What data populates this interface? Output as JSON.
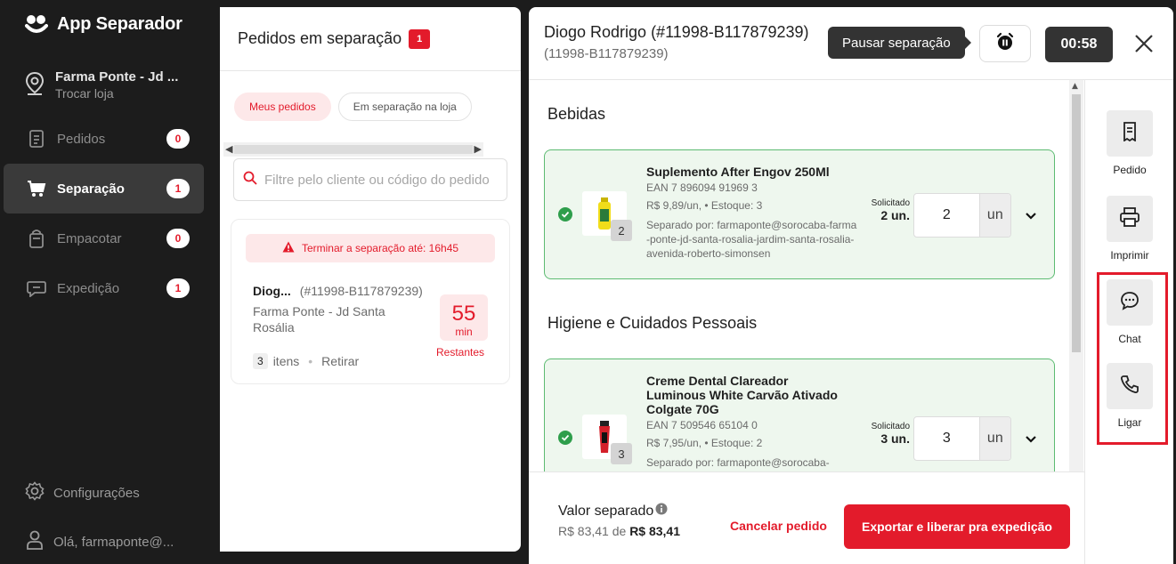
{
  "app": {
    "name": "App Separador"
  },
  "store": {
    "name": "Farma Ponte - Jd ...",
    "action": "Trocar loja"
  },
  "nav": [
    {
      "label": "Pedidos",
      "count": "0",
      "icon": "receipt-icon"
    },
    {
      "label": "Separação",
      "count": "1",
      "icon": "cart-icon"
    },
    {
      "label": "Empacotar",
      "count": "0",
      "icon": "bag-icon"
    },
    {
      "label": "Expedição",
      "count": "1",
      "icon": "chat-bubble-icon"
    }
  ],
  "bottom_nav": {
    "settings": "Configurações",
    "user": "Olá, farmaponte@..."
  },
  "orders_panel": {
    "title": "Pedidos em separação",
    "count": "1",
    "tabs": [
      "Meus pedidos",
      "Em separação na loja"
    ],
    "search_placeholder": "Filtre pelo cliente ou código do pedido",
    "order": {
      "deadline": "Terminar a separação até: 16h45",
      "customer": "Diog...",
      "code": "(#11998-B117879239)",
      "store": "Farma Ponte - Jd Santa Rosália",
      "minutes": "55",
      "minutes_unit": "min",
      "remaining_label": "Restantes",
      "items_count": "3",
      "items_label": "itens",
      "delivery": "Retirar"
    }
  },
  "detail": {
    "customer": "Diogo Rodrigo  (#11998-B117879239)",
    "code": "(11998-B117879239)",
    "tooltip": "Pausar separação",
    "timer": "00:58",
    "sections": [
      {
        "title": "Bebidas",
        "items": [
          {
            "name": "Suplemento After Engov 250Ml",
            "ean": "EAN 7 896094 91969 3",
            "price": "R$ 9,89/un, • Estoque: 3",
            "separated_by": "Separado por: farmaponte@sorocaba-farma-ponte-jd-santa-rosalia-jardim-santa-rosalia-avenida-roberto-simonsen",
            "badge": "2",
            "requested_label": "Solicitado",
            "requested": "2 un.",
            "qty": "2",
            "unit": "un"
          }
        ]
      },
      {
        "title": "Higiene e Cuidados Pessoais",
        "items": [
          {
            "name": "Creme Dental Clareador Luminous White Carvão Ativado Colgate 70G",
            "ean": "EAN 7 509546 65104 0",
            "price": "R$ 7,95/un, • Estoque: 2",
            "separated_by": "Separado por: farmaponte@sorocaba-",
            "badge": "3",
            "requested_label": "Solicitado",
            "requested": "3 un.",
            "qty": "3",
            "unit": "un"
          }
        ]
      }
    ],
    "footer": {
      "value_label": "Valor separado",
      "value_from": "R$ 83,41 de",
      "value_total": "R$ 83,41",
      "cancel": "Cancelar pedido",
      "export": "Exportar e liberar pra expedição"
    },
    "rail": [
      "Pedido",
      "Imprimir",
      "Chat",
      "Ligar"
    ]
  },
  "colors": {
    "brand": "#e31b2b",
    "sidebar_bg": "#1c1c1c",
    "success": "#2e9e4b"
  }
}
